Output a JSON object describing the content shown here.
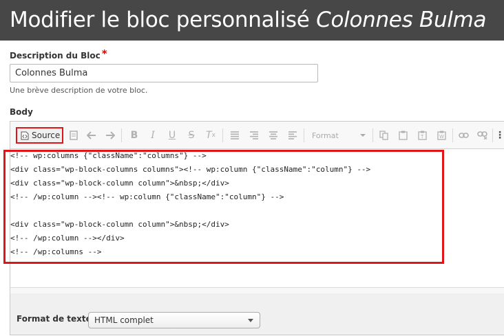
{
  "header": {
    "title_prefix": "Modifier le bloc personnalisé",
    "title_block": "Colonnes Bulma"
  },
  "description_field": {
    "label": "Description du Bloc",
    "required_mark": "*",
    "value": "Colonnes Bulma",
    "help": "Une brève description de votre bloc."
  },
  "body_field": {
    "label": "Body"
  },
  "toolbar": {
    "source_label": "Source",
    "format_label": "Format"
  },
  "code_lines": [
    "<!-- wp:columns {\"className\":\"columns\"} -->",
    "<div class=\"wp-block-columns columns\"><!-- wp:column {\"className\":\"column\"} -->",
    "<div class=\"wp-block-column column\">&nbsp;</div>",
    "<!-- /wp:column --><!-- wp:column {\"className\":\"column\"} -->",
    "",
    "<div class=\"wp-block-column column\">&nbsp;</div>",
    "<!-- /wp:column --></div>",
    "<!-- /wp:columns -->"
  ],
  "text_format": {
    "label": "Format de texte",
    "selected": "HTML complet"
  },
  "colors": {
    "header_bg": "#474747",
    "highlight": "#e0151a",
    "required": "#e00000"
  }
}
